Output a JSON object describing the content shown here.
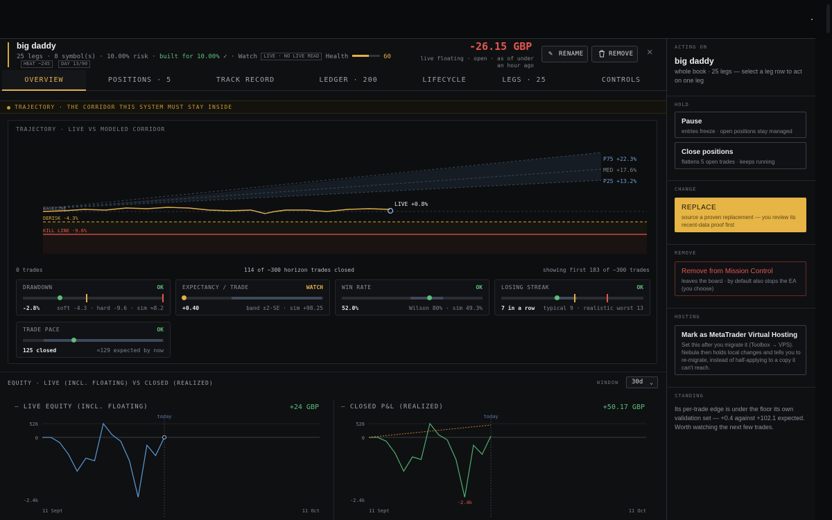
{
  "header": {
    "title": "big daddy",
    "meta": {
      "legs": "25 legs",
      "symbols": "8 symbol(s)",
      "risk": "10.00% risk",
      "built": "built for 10.00% ✓",
      "watch": "Watch",
      "live_pill": "LIVE · NO LIVE READ",
      "health_label": "Health",
      "health_value": "60",
      "health_fraction": 0.6
    },
    "tags": [
      "HEAT ~245",
      "DAY 13/90"
    ],
    "pnl": "-26.15 GBP",
    "pnl_sub": "live floating · open · as of under an hour ago",
    "rename": "RENAME",
    "remove": "REMOVE"
  },
  "tabs": [
    "OVERVIEW",
    "POSITIONS · 5",
    "TRACK RECORD",
    "LEDGER · 200",
    "LIFECYCLE",
    "LEGS · 25",
    "CONTROLS"
  ],
  "trajectory": {
    "banner": "TRAJECTORY · THE CORRIDOR THIS SYSTEM MUST STAY INSIDE",
    "card_title": "TRAJECTORY · LIVE VS MODELED CORRIDOR",
    "labels": {
      "p75": "P75 +22.3%",
      "med": "MED +17.6%",
      "p25": "P25 +13.2%",
      "live": "LIVE +0.8%",
      "baseline": "BASELINE",
      "derisk": "DERISK -4.3%",
      "kill": "KILL LINE -9.6%"
    },
    "footer_left": "0 trades",
    "footer_mid": "114 of ~300 horizon trades closed",
    "footer_right": "showing first 183 of ~300 trades"
  },
  "metrics": [
    {
      "name": "DRAWDOWN",
      "status": "OK",
      "status_color": "#5bbf7a",
      "value": "-2.8%",
      "note": "soft -4.3 · hard -9.6 · sim ≈8.2"
    },
    {
      "name": "EXPECTANCY / TRADE",
      "status": "WATCH",
      "status_color": "#e2b04a",
      "value": "+0.40",
      "note": "band ±2·SE · sim +98.25"
    },
    {
      "name": "WIN RATE",
      "status": "OK",
      "status_color": "#5bbf7a",
      "value": "52.0%",
      "note": "Wilson 80% · sim 49.3%"
    },
    {
      "name": "LOSING STREAK",
      "status": "OK",
      "status_color": "#5bbf7a",
      "value": "7 in a row",
      "note": "typical 9 · realistic worst 13"
    },
    {
      "name": "TRADE PACE",
      "status": "OK",
      "status_color": "#5bbf7a",
      "value": "125 closed",
      "note": "≈129 expected by now"
    }
  ],
  "equity": {
    "title": "EQUITY · LIVE (INCL. FLOATING) VS CLOSED (REALIZED)",
    "window_label": "WINDOW",
    "window_value": "30d",
    "live": {
      "label": "LIVE EQUITY (INCL. FLOATING)",
      "amount": "+24 GBP"
    },
    "closed": {
      "label": "CLOSED P&L (REALIZED)",
      "amount": "+50.17 GBP",
      "min_label": "-2.4k"
    },
    "axis": {
      "y_top": "526",
      "y_zero": "0",
      "y_bottom": "-2.4k",
      "x_start": "11 Sept",
      "x_end": "11 Oct",
      "today": "today"
    }
  },
  "chart_data": [
    {
      "type": "line",
      "title": "LIVE EQUITY (INCL. FLOATING)",
      "x": [
        "11 Sept",
        "11 Oct"
      ],
      "ylim": [
        -2400,
        526
      ],
      "series": [
        {
          "values": [
            0,
            0,
            -200,
            -650,
            -1300,
            -800,
            -900,
            526,
            100,
            -150,
            -900,
            -2300,
            -300,
            -700,
            0
          ]
        }
      ]
    },
    {
      "type": "line",
      "title": "CLOSED P&L (REALIZED)",
      "x": [
        "11 Sept",
        "11 Oct"
      ],
      "ylim": [
        -2400,
        526
      ],
      "series": [
        {
          "values": [
            0,
            0,
            -150,
            -600,
            -1300,
            -750,
            -850,
            526,
            100,
            -100,
            -850,
            -2300,
            -300,
            -650,
            50
          ]
        }
      ]
    }
  ],
  "side": {
    "acting_label": "ACTING ON",
    "acting_title": "big daddy",
    "acting_desc": "whole book · 25 legs — select a leg row to act on one leg",
    "hold_label": "HOLD",
    "pause": {
      "title": "Pause",
      "desc": "entries freeze · open positions stay managed"
    },
    "close": {
      "title": "Close positions",
      "desc": "flattens 5 open trades · keeps running"
    },
    "change_label": "CHANGE",
    "replace": {
      "title": "REPLACE",
      "desc": "source a proven replacement — you review its recent-data proof first"
    },
    "remove_label": "REMOVE",
    "remove": {
      "title": "Remove from Mission Control",
      "desc": "leaves the board · by default also stops the EA (you choose)"
    },
    "hosting_label": "HOSTING",
    "hosting": {
      "title": "Mark as MetaTrader Virtual Hosting",
      "desc": "Set this after you migrate it (Toolbox → VPS). Nebula then holds local changes and tells you to re-migrate, instead of half-applying to a copy it can't reach."
    },
    "standing_label": "STANDING",
    "standing_desc": "Its per-trade edge is under the floor its own validation set — +0.4 against +102.1 expected. Worth watching the next few trades."
  },
  "colors": {
    "accent": "#e2b04a",
    "danger": "#e3574e",
    "positive": "#5bbf7a",
    "live_line": "#5b9ad8",
    "closed_line": "#4fae72"
  }
}
